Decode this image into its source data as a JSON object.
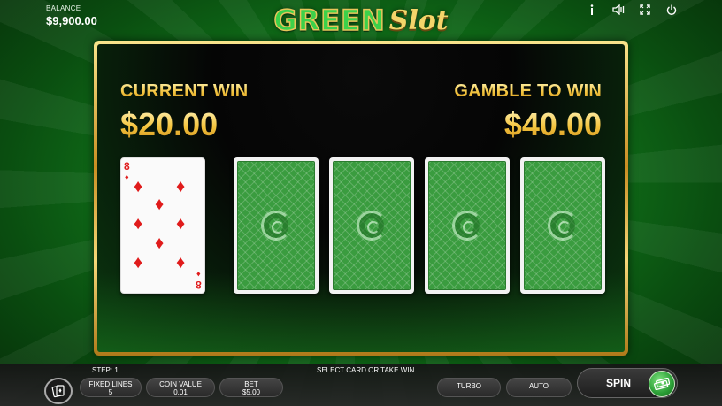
{
  "balance": {
    "label": "BALANCE",
    "value": "$9,900.00"
  },
  "logo": {
    "part1": "GREEN",
    "part2": "Slot"
  },
  "top_icons": [
    "info-icon",
    "sound-icon",
    "fullscreen-icon",
    "power-icon"
  ],
  "gamble": {
    "current_win_label": "CURRENT WIN",
    "current_win_value": "$20.00",
    "gamble_label": "GAMBLE TO WIN",
    "gamble_value": "$40.00",
    "revealed_card": {
      "rank": "8",
      "suit": "diamonds",
      "suit_symbol": "♦"
    },
    "hidden_cards": 4
  },
  "bottom": {
    "step": "STEP: 1",
    "message": "SELECT CARD OR TAKE WIN",
    "fixed_lines": {
      "label": "FIXED LINES",
      "value": "5"
    },
    "coin_value": {
      "label": "COIN VALUE",
      "value": "0.01"
    },
    "bet": {
      "label": "BET",
      "value": "$5.00"
    },
    "turbo": "TURBO",
    "auto": "AUTO",
    "spin": "SPIN"
  },
  "colors": {
    "accent_gold": "#f2c23c",
    "table_green": "#127a1c",
    "card_red": "#e01b1b"
  }
}
